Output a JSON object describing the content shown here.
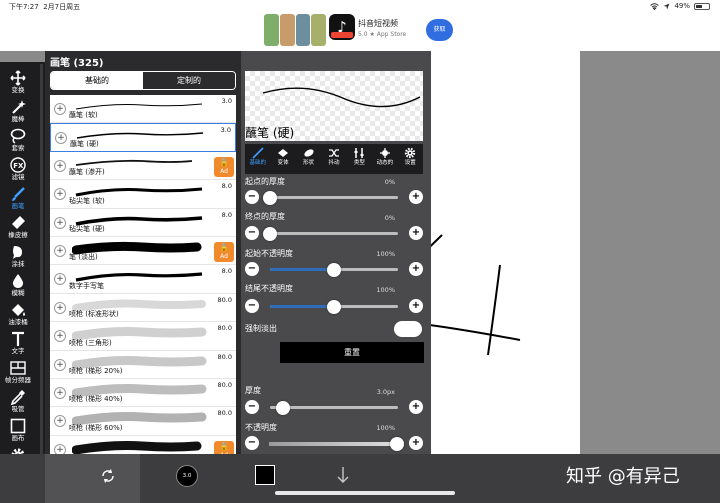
{
  "status_bar": {
    "time": "下午7:27",
    "date": "2月7日周五",
    "battery": "49%"
  },
  "ad": {
    "app_name": "抖音短视频",
    "rating": "5.0",
    "store": "App Store",
    "button": "获取"
  },
  "toolbar": [
    {
      "icon": "move-icon",
      "label": "变换"
    },
    {
      "icon": "magic-wand-icon",
      "label": "魔棒"
    },
    {
      "icon": "lasso-icon",
      "label": "套索"
    },
    {
      "icon": "fx-icon",
      "label": "滤镜"
    },
    {
      "icon": "brush-icon",
      "label": "画笔",
      "active": true
    },
    {
      "icon": "eraser-icon",
      "label": "橡皮擦"
    },
    {
      "icon": "smudge-icon",
      "label": "涂抹"
    },
    {
      "icon": "blur-icon",
      "label": "模糊"
    },
    {
      "icon": "bucket-icon",
      "label": "油漆桶"
    },
    {
      "icon": "text-icon",
      "label": "文字"
    },
    {
      "icon": "frame-divider-icon",
      "label": "帧分频器"
    },
    {
      "icon": "eyedropper-icon",
      "label": "吸管"
    },
    {
      "icon": "canvas-icon",
      "label": "画布"
    },
    {
      "icon": "settings-icon",
      "label": "设置"
    }
  ],
  "brush_panel": {
    "title": "画笔 (325)",
    "tabs": [
      "基础的",
      "定制的"
    ],
    "brushes": [
      {
        "name": "蘸笔 (软)",
        "size": "3.0"
      },
      {
        "name": "蘸笔 (硬)",
        "size": "3.0",
        "selected": true
      },
      {
        "name": "蘸笔 (渗开)",
        "size": "",
        "locked": true
      },
      {
        "name": "毡尖笔 (软)",
        "size": "8.0"
      },
      {
        "name": "毡尖笔 (硬)",
        "size": "8.0"
      },
      {
        "name": "笔 (淡出)",
        "size": "",
        "locked": true
      },
      {
        "name": "数字手写笔",
        "size": "8.0"
      },
      {
        "name": "喷枪 (标准形状)",
        "size": "80.0"
      },
      {
        "name": "喷枪 (三角形)",
        "size": "80.0"
      },
      {
        "name": "喷枪 (梯形 20%)",
        "size": "80.0"
      },
      {
        "name": "喷枪 (梯形 40%)",
        "size": "80.0"
      },
      {
        "name": "喷枪 (梯形 60%)",
        "size": "80.0"
      },
      {
        "name": "",
        "size": "",
        "locked": true
      }
    ],
    "lock_label": "Ad"
  },
  "properties": {
    "brush_name": "蘸笔 (硬)",
    "tabs": [
      {
        "icon": "brush-icon",
        "label": "基础的"
      },
      {
        "icon": "diamond-icon",
        "label": "变体"
      },
      {
        "icon": "ellipse-icon",
        "label": "形状"
      },
      {
        "icon": "shuffle-icon",
        "label": "抖动"
      },
      {
        "icon": "type-icon",
        "label": "类型"
      },
      {
        "icon": "dynamics-icon",
        "label": "动态的"
      },
      {
        "icon": "gear-icon",
        "label": "设置"
      }
    ],
    "sliders": [
      {
        "label": "起点的厚度",
        "value": "0%",
        "fraction": 0.0
      },
      {
        "label": "终点的厚度",
        "value": "0%",
        "fraction": 0.0
      },
      {
        "label": "起始不透明度",
        "value": "100%",
        "fraction": 0.5
      },
      {
        "label": "结尾不透明度",
        "value": "100%",
        "fraction": 0.5
      }
    ],
    "force_fade_label": "强制淡出",
    "force_fade_on": false,
    "reset_label": "重置",
    "thickness": {
      "label": "厚度",
      "value": "3.0px",
      "fraction": 0.1
    },
    "opacity": {
      "label": "不透明度",
      "value": "100%",
      "fraction": 1.0
    }
  },
  "bottom_bar": {
    "brush_size_label": "3.0"
  },
  "watermark": "知乎 @有异己"
}
